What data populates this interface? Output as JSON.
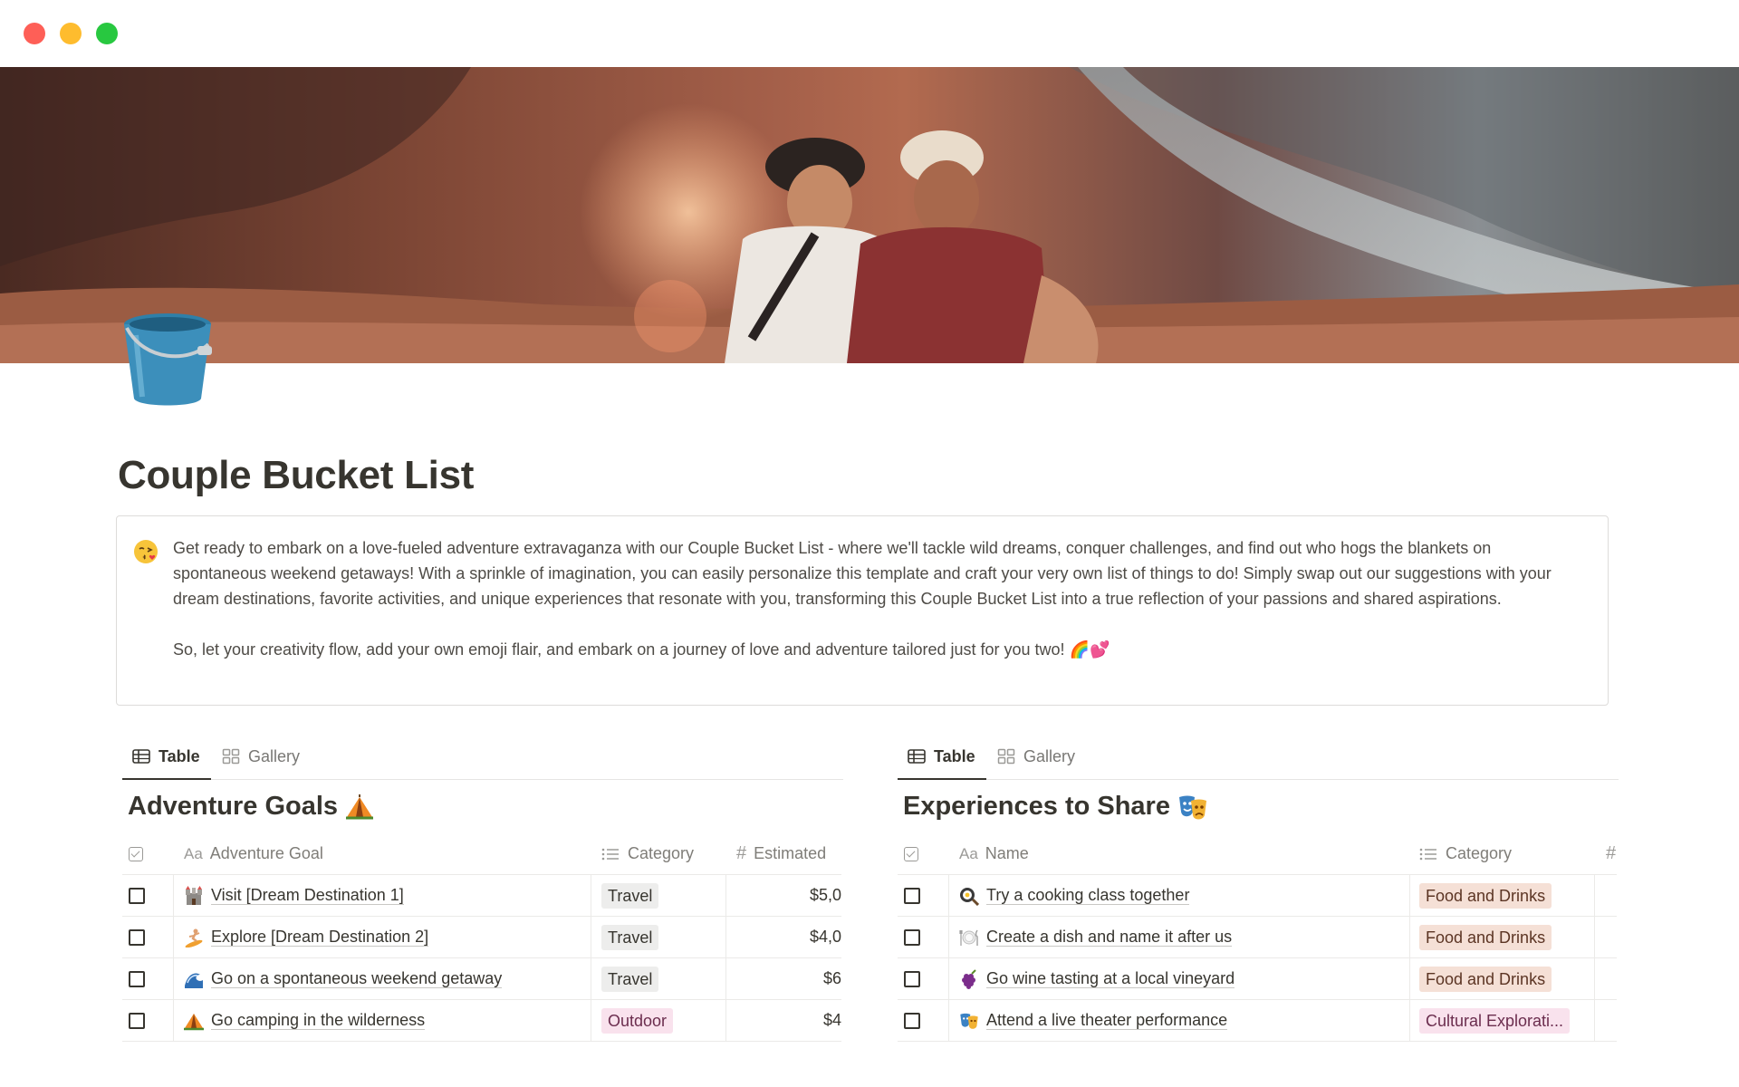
{
  "window": {
    "controls": [
      "close",
      "minimize",
      "maximize"
    ]
  },
  "cover": {
    "description_icon": "cover-photo"
  },
  "page": {
    "icon": "bucket-icon",
    "title": "Couple Bucket List"
  },
  "callout": {
    "emoji": "kissing-face-icon",
    "paragraph1": "Get ready to embark on a love-fueled adventure extravaganza with our Couple Bucket List - where we'll tackle wild dreams, conquer challenges, and find out who hogs the blankets on spontaneous weekend getaways! With a sprinkle of imagination, you can easily personalize this template and craft your very own list of things to do! Simply swap out our suggestions with your dream destinations, favorite activities, and unique experiences that resonate with you, transforming this Couple Bucket List into a true reflection of your passions and shared aspirations.",
    "paragraph2": "So, let your creativity flow, add your own emoji flair, and embark on a journey of love and adventure tailored just for you two! 🌈💕"
  },
  "adventure": {
    "tabs": [
      {
        "label": "Table",
        "icon": "table-icon"
      },
      {
        "label": "Gallery",
        "icon": "gallery-icon"
      }
    ],
    "title": "Adventure Goals",
    "title_icon": "tent-icon",
    "columns": {
      "check_icon": "checkbox-icon",
      "name_prefix": "Aa",
      "name": "Adventure Goal",
      "category_icon": "list-icon",
      "category": "Category",
      "estimate_icon": "#",
      "estimate": "Estimated"
    },
    "rows": [
      {
        "icon": "castle-icon",
        "name": "Visit [Dream Destination 1]",
        "category": "Travel",
        "estimate": "$5,0"
      },
      {
        "icon": "surfer-icon",
        "name": "Explore [Dream Destination 2]",
        "category": "Travel",
        "estimate": "$4,0"
      },
      {
        "icon": "wave-icon",
        "name": "Go on a spontaneous weekend getaway",
        "category": "Travel",
        "estimate": "$6"
      },
      {
        "icon": "tent-icon",
        "name": "Go camping in the wilderness",
        "category": "Outdoor",
        "estimate": "$4"
      }
    ]
  },
  "experiences": {
    "tabs": [
      {
        "label": "Table",
        "icon": "table-icon"
      },
      {
        "label": "Gallery",
        "icon": "gallery-icon"
      }
    ],
    "title": "Experiences to Share",
    "title_icon": "theater-masks-icon",
    "columns": {
      "check_icon": "checkbox-icon",
      "name_prefix": "Aa",
      "name": "Name",
      "category_icon": "list-icon",
      "category": "Category",
      "extra_icon": "#"
    },
    "rows": [
      {
        "icon": "cooking-pan-icon",
        "name": "Try a cooking class together",
        "category": "Food and Drinks"
      },
      {
        "icon": "plate-icon",
        "name": "Create a dish and name it after us",
        "category": "Food and Drinks"
      },
      {
        "icon": "grapes-icon",
        "name": "Go wine tasting at a local vineyard",
        "category": "Food and Drinks"
      },
      {
        "icon": "theater-masks-icon",
        "name": "Attend a live theater performance",
        "category": "Cultural Explorati..."
      }
    ]
  }
}
